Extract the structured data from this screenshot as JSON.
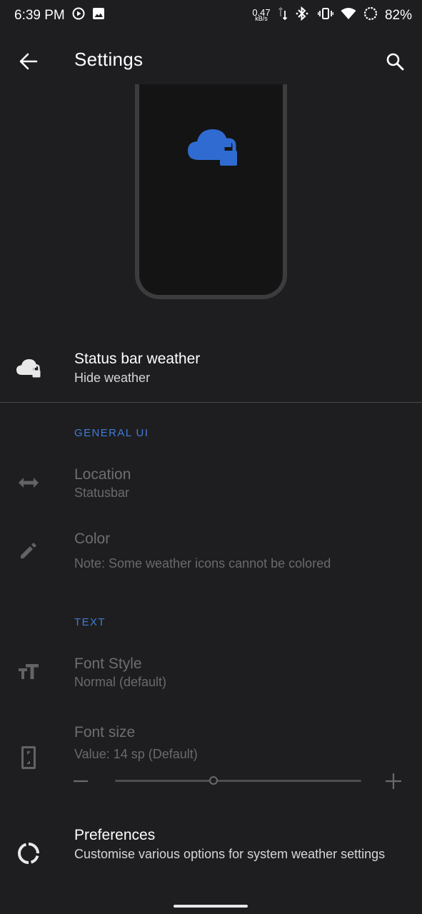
{
  "status_bar": {
    "time": "6:39 PM",
    "net_speed_value": "0.47",
    "net_speed_unit": "kB/s",
    "battery": "82%"
  },
  "app_bar": {
    "title": "Settings"
  },
  "status_bar_weather": {
    "title": "Status bar weather",
    "subtitle": "Hide weather"
  },
  "general_ui": {
    "header": "GENERAL UI",
    "location": {
      "title": "Location",
      "subtitle": "Statusbar"
    },
    "color": {
      "title": "Color",
      "subtitle": "Note: Some weather icons cannot be colored"
    }
  },
  "text_section": {
    "header": "TEXT",
    "font_style": {
      "title": "Font Style",
      "subtitle": "Normal (default)"
    },
    "font_size": {
      "title": "Font size",
      "subtitle": "Value: 14 sp (Default)",
      "slider_fraction": 0.4
    }
  },
  "preferences": {
    "title": "Preferences",
    "subtitle": "Customise various options for system weather settings"
  },
  "colors": {
    "accent": "#3f7bd8",
    "background": "#1e1e20",
    "cloud_icon": "#2f6bd1"
  }
}
